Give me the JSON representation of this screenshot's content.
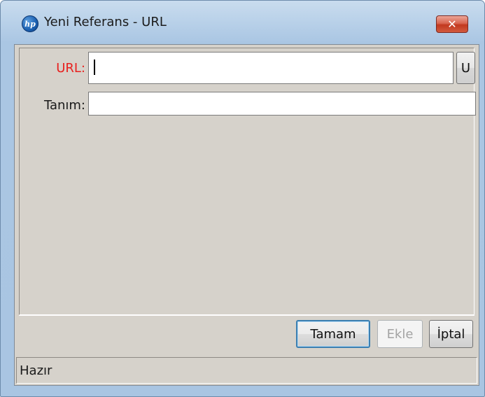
{
  "window": {
    "title": "Yeni Referans - URL",
    "app_icon_text": "hp",
    "close_symbol": "✕"
  },
  "form": {
    "url_label": "URL:",
    "url_value": "",
    "url_button_label": "U",
    "description_label": "Tanım:",
    "description_value": ""
  },
  "buttons": {
    "ok_label": "Tamam",
    "add_label": "Ekle",
    "cancel_label": "İptal"
  },
  "status": {
    "text": "Hazır"
  },
  "colors": {
    "required_label": "#e8201e",
    "client_background": "#d6d2cb",
    "close_button": "#c2391f"
  },
  "icons": {
    "app": "hp-logo-icon",
    "close": "close-icon"
  }
}
